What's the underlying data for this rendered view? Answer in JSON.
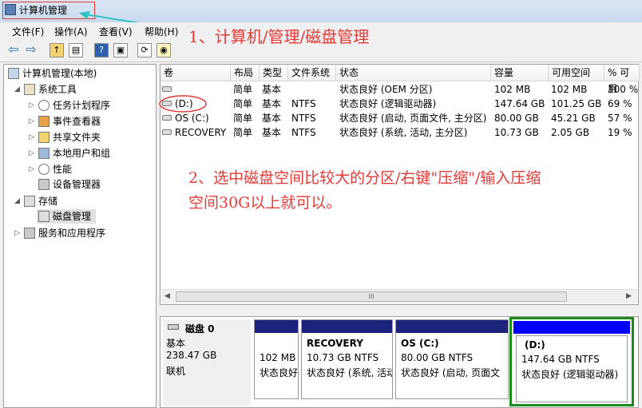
{
  "window": {
    "title": "计算机管理"
  },
  "menu": [
    "文件(F)",
    "操作(A)",
    "查看(V)",
    "帮助(H)"
  ],
  "toolbar_icons": [
    "back-icon",
    "forward-icon",
    "up-folder-icon",
    "console-tree-icon",
    "help-icon",
    "properties-icon",
    "refresh-icon",
    "disk-icon"
  ],
  "tree": {
    "root": "计算机管理(本地)",
    "items": [
      {
        "label": "系统工具",
        "level": 1,
        "expanded": true
      },
      {
        "label": "任务计划程序",
        "level": 2
      },
      {
        "label": "事件查看器",
        "level": 2
      },
      {
        "label": "共享文件夹",
        "level": 2
      },
      {
        "label": "本地用户和组",
        "level": 2
      },
      {
        "label": "性能",
        "level": 2
      },
      {
        "label": "设备管理器",
        "level": 2
      },
      {
        "label": "存储",
        "level": 1,
        "expanded": true
      },
      {
        "label": "磁盘管理",
        "level": 2,
        "selected": true
      },
      {
        "label": "服务和应用程序",
        "level": 1
      }
    ]
  },
  "volumes": {
    "headers": [
      "卷",
      "布局",
      "类型",
      "文件系统",
      "状态",
      "容量",
      "可用空间",
      "% 可用"
    ],
    "rows": [
      [
        "",
        "简单",
        "基本",
        "",
        "状态良好 (OEM 分区)",
        "102 MB",
        "102 MB",
        "100 %"
      ],
      [
        "(D:)",
        "简单",
        "基本",
        "NTFS",
        "状态良好 (逻辑驱动器)",
        "147.64 GB",
        "101.25 GB",
        "69 %"
      ],
      [
        "OS (C:)",
        "简单",
        "基本",
        "NTFS",
        "状态良好 (启动, 页面文件, 主分区)",
        "80.00 GB",
        "45.21 GB",
        "57 %"
      ],
      [
        "RECOVERY",
        "简单",
        "基本",
        "NTFS",
        "状态良好 (系统, 活动, 主分区)",
        "10.73 GB",
        "2.05 GB",
        "19 %"
      ]
    ],
    "scroll_glyph": "III"
  },
  "disk": {
    "name": "磁盘 0",
    "type": "基本",
    "size": "238.47 GB",
    "status": "联机",
    "partitions": [
      {
        "title": "",
        "size": "102 MB",
        "status": "状态良好"
      },
      {
        "title": "RECOVERY",
        "size": "10.73 GB NTFS",
        "status": "状态良好 (系统, 活动"
      },
      {
        "title": "OS  (C:)",
        "size": "80.00 GB NTFS",
        "status": "状态良好 (启动, 页面文"
      },
      {
        "title": "(D:)",
        "size": "147.64 GB NTFS",
        "status": "状态良好 (逻辑驱动器)"
      }
    ]
  },
  "annotations": {
    "step1": "1、计算机/管理/磁盘管理",
    "step2_line1": "2、选中磁盘空间比较大的分区/右键\"压缩\"/输入压缩",
    "step2_line2": "空间30G以上就可以。"
  },
  "colors": {
    "annotation": "#e53935",
    "partition_bar": "#1b237a",
    "logical_bar": "#0000ff",
    "highlight": "#1a8c1a"
  }
}
